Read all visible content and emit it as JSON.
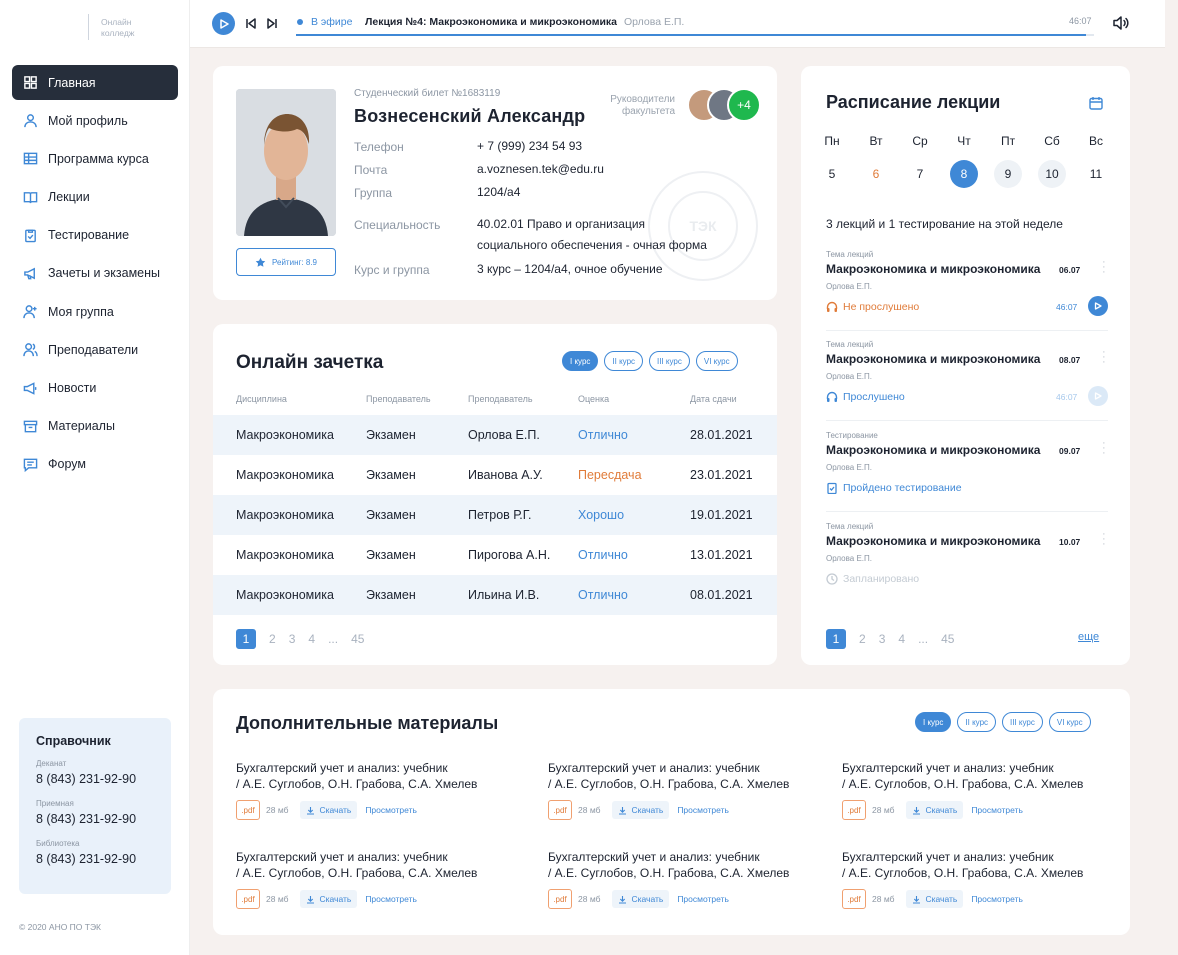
{
  "app": {
    "logo_line1": "Онлайн",
    "logo_line2": "колледж",
    "copyright": "© 2020 АНО ПО ТЭК"
  },
  "sidebar": {
    "items": [
      {
        "label": "Главная",
        "icon": "grid-icon",
        "active": true
      },
      {
        "label": "Мой профиль",
        "icon": "user-icon"
      },
      {
        "label": "Программа курса",
        "icon": "table-icon"
      },
      {
        "label": "Лекции",
        "icon": "book-icon"
      },
      {
        "label": "Тестирование",
        "icon": "clipboard-icon"
      },
      {
        "label": "Зачеты и экзамены",
        "icon": "megaphone-icon"
      },
      {
        "label": "Моя группа",
        "icon": "user-plus-icon"
      },
      {
        "label": "Преподаватели",
        "icon": "users-icon"
      },
      {
        "label": "Новости",
        "icon": "news-icon"
      },
      {
        "label": "Материалы",
        "icon": "archive-icon"
      },
      {
        "label": "Форум",
        "icon": "chat-icon"
      }
    ],
    "reference": {
      "title": "Справочник",
      "entries": [
        {
          "label": "Деканат",
          "phone": "8 (843) 231-92-90"
        },
        {
          "label": "Приемная",
          "phone": "8 (843) 231-92-90"
        },
        {
          "label": "Библиотека",
          "phone": "8 (843) 231-92-90"
        }
      ]
    }
  },
  "player": {
    "status": "В эфире",
    "title": "Лекция №4: Макроэкономика и микроэкономика",
    "author": "Орлова Е.П.",
    "time": "46:07",
    "progress": 0.99
  },
  "profile": {
    "student_id": "Студенческий билет №1683119",
    "name": "Вознесенский Александр",
    "rating": "Рейтинг: 8.9",
    "heads_label_line1": "Руководители",
    "heads_label_line2": "факультета",
    "heads_more": "+4",
    "stamp_text": "ТЭК",
    "fields": [
      {
        "key": "Телефон",
        "value": "+ 7 (999) 234 54 93"
      },
      {
        "key": "Почта",
        "value": "a.voznesen.tek@edu.ru"
      },
      {
        "key": "Группа",
        "value": "1204/а4"
      },
      {
        "key": "Специальность",
        "value": "40.02.01 Право и организация",
        "value2": "социального обеспечения - очная форма"
      },
      {
        "key": "Курс и группа",
        "value": "3 курс – 1204/а4, очное обучение"
      }
    ]
  },
  "grades": {
    "title": "Онлайн зачетка",
    "courses": [
      "I курс",
      "II курс",
      "III курс",
      "VI курс"
    ],
    "headers": [
      "Дисциплина",
      "Преподаватель",
      "Преподаватель",
      "Оценка",
      "Дата сдачи"
    ],
    "rows": [
      {
        "discipline": "Макроэкономика",
        "type": "Экзамен",
        "teacher": "Орлова Е.П.",
        "grade": "Отлично",
        "grade_color": "#3f88d6",
        "date": "28.01.2021"
      },
      {
        "discipline": "Макроэкономика",
        "type": "Экзамен",
        "teacher": "Иванова А.У.",
        "grade": "Пересдача",
        "grade_color": "#e07b39",
        "date": "23.01.2021"
      },
      {
        "discipline": "Макроэкономика",
        "type": "Экзамен",
        "teacher": "Петров Р.Г.",
        "grade": "Хорошо",
        "grade_color": "#3f88d6",
        "date": "19.01.2021"
      },
      {
        "discipline": "Макроэкономика",
        "type": "Экзамен",
        "teacher": "Пирогова А.Н.",
        "grade": "Отлично",
        "grade_color": "#3f88d6",
        "date": "13.01.2021"
      },
      {
        "discipline": "Макроэкономика",
        "type": "Экзамен",
        "teacher": "Ильина И.В.",
        "grade": "Отлично",
        "grade_color": "#3f88d6",
        "date": "08.01.2021"
      }
    ],
    "pages": [
      "1",
      "2",
      "3",
      "4",
      "...",
      "45"
    ]
  },
  "schedule": {
    "title": "Расписание лекции",
    "weekdays": [
      "Пн",
      "Вт",
      "Ср",
      "Чт",
      "Пт",
      "Сб",
      "Вс"
    ],
    "dates": [
      "5",
      "6",
      "7",
      "8",
      "9",
      "10",
      "11"
    ],
    "summary": "3 лекций и 1 тестирование на этой неделе",
    "items": [
      {
        "type": "Тема лекций",
        "name": "Макроэкономика и микроэкономика",
        "date": "06.07",
        "author": "Орлова Е.П.",
        "status": "Не прослушено",
        "time": "46:07"
      },
      {
        "type": "Тема лекций",
        "name": "Макроэкономика и микроэкономика",
        "date": "08.07",
        "author": "Орлова Е.П.",
        "status": "Прослушено",
        "time": "46:07"
      },
      {
        "type": "Тестирование",
        "name": "Макроэкономика и микроэкономика",
        "date": "09.07",
        "author": "Орлова Е.П.",
        "status": "Пройдено тестирование"
      },
      {
        "type": "Тема лекций",
        "name": "Макроэкономика и микроэкономика",
        "date": "10.07",
        "author": "Орлова Е.П.",
        "status": "Запланировано"
      }
    ],
    "pages": [
      "1",
      "2",
      "3",
      "4",
      "...",
      "45"
    ],
    "more": "еще"
  },
  "materials": {
    "title": "Дополнительные материалы",
    "courses": [
      "I курс",
      "II курс",
      "III курс",
      "VI курс"
    ],
    "item": {
      "line1": "Бухгалтерский учет и анализ: учебник",
      "line2": "/ А.Е. Суглобов, О.Н. Грабова, С.А. Хмелев",
      "ext": ".pdf",
      "size": "28 мб",
      "download": "Скачать",
      "view": "Просмотреть"
    }
  }
}
